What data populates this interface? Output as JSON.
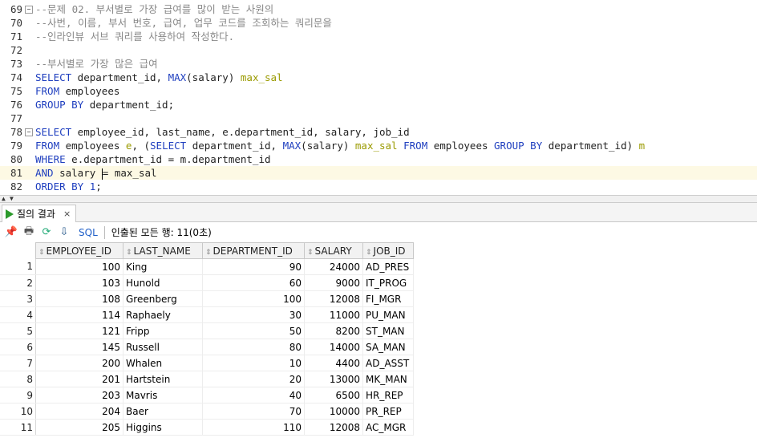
{
  "editor": {
    "lines": [
      {
        "no": "69",
        "fold": true,
        "html": "<span class=\"cm\">--문제 02. 부서별로 가장 급여를 많이 받는 사원의</span>"
      },
      {
        "no": "70",
        "fold": false,
        "html": "<span class=\"cm\">--사번, 이름, 부서 번호, 급여, 업무 코드를 조회하는 쿼리문을</span>"
      },
      {
        "no": "71",
        "fold": false,
        "html": "<span class=\"cm\">--인라인뷰 서브 쿼리를 사용하여 작성한다.</span>"
      },
      {
        "no": "72",
        "fold": false,
        "html": ""
      },
      {
        "no": "73",
        "fold": false,
        "html": "<span class=\"cm\">--부서별로 가장 많은 급여</span>"
      },
      {
        "no": "74",
        "fold": false,
        "html": "<span class=\"kw\">SELECT</span> department_id, <span class=\"fn\">MAX</span>(salary) <span class=\"al\">max_sal</span>"
      },
      {
        "no": "75",
        "fold": false,
        "html": "<span class=\"kw\">FROM</span> employees"
      },
      {
        "no": "76",
        "fold": false,
        "html": "<span class=\"kw\">GROUP BY</span> department_id;"
      },
      {
        "no": "77",
        "fold": false,
        "html": ""
      },
      {
        "no": "78",
        "fold": true,
        "html": "<span class=\"kw\">SELECT</span> employee_id, last_name, e.department_id, salary, job_id"
      },
      {
        "no": "79",
        "fold": false,
        "html": "<span class=\"kw\">FROM</span> employees <span class=\"al\">e</span>, (<span class=\"kw\">SELECT</span> department_id, <span class=\"fn\">MAX</span>(salary) <span class=\"al\">max_sal</span> <span class=\"kw\">FROM</span> employees <span class=\"kw\">GROUP BY</span> department_id) <span class=\"al\">m</span>"
      },
      {
        "no": "80",
        "fold": false,
        "html": "<span class=\"kw\">WHERE</span> e.department_id = m.department_id"
      },
      {
        "no": "81",
        "fold": false,
        "active": true,
        "html": "<span class=\"kw\">AND</span> salary <span class=\"caret\"></span>= max_sal"
      },
      {
        "no": "82",
        "fold": false,
        "html": "<span class=\"kw\">ORDER BY</span> <span class=\"num\">1</span>;"
      }
    ]
  },
  "results_tab": {
    "label": "질의 결과",
    "close": "×"
  },
  "toolbar": {
    "sql_label": "SQL",
    "status": "인출된 모든 행: 11(0초)"
  },
  "grid": {
    "columns": [
      "EMPLOYEE_ID",
      "LAST_NAME",
      "DEPARTMENT_ID",
      "SALARY",
      "JOB_ID"
    ],
    "rows": [
      [
        "1",
        "100",
        "King",
        "90",
        "24000",
        "AD_PRES"
      ],
      [
        "2",
        "103",
        "Hunold",
        "60",
        "9000",
        "IT_PROG"
      ],
      [
        "3",
        "108",
        "Greenberg",
        "100",
        "12008",
        "FI_MGR"
      ],
      [
        "4",
        "114",
        "Raphaely",
        "30",
        "11000",
        "PU_MAN"
      ],
      [
        "5",
        "121",
        "Fripp",
        "50",
        "8200",
        "ST_MAN"
      ],
      [
        "6",
        "145",
        "Russell",
        "80",
        "14000",
        "SA_MAN"
      ],
      [
        "7",
        "200",
        "Whalen",
        "10",
        "4400",
        "AD_ASST"
      ],
      [
        "8",
        "201",
        "Hartstein",
        "20",
        "13000",
        "MK_MAN"
      ],
      [
        "9",
        "203",
        "Mavris",
        "40",
        "6500",
        "HR_REP"
      ],
      [
        "10",
        "204",
        "Baer",
        "70",
        "10000",
        "PR_REP"
      ],
      [
        "11",
        "205",
        "Higgins",
        "110",
        "12008",
        "AC_MGR"
      ]
    ]
  }
}
